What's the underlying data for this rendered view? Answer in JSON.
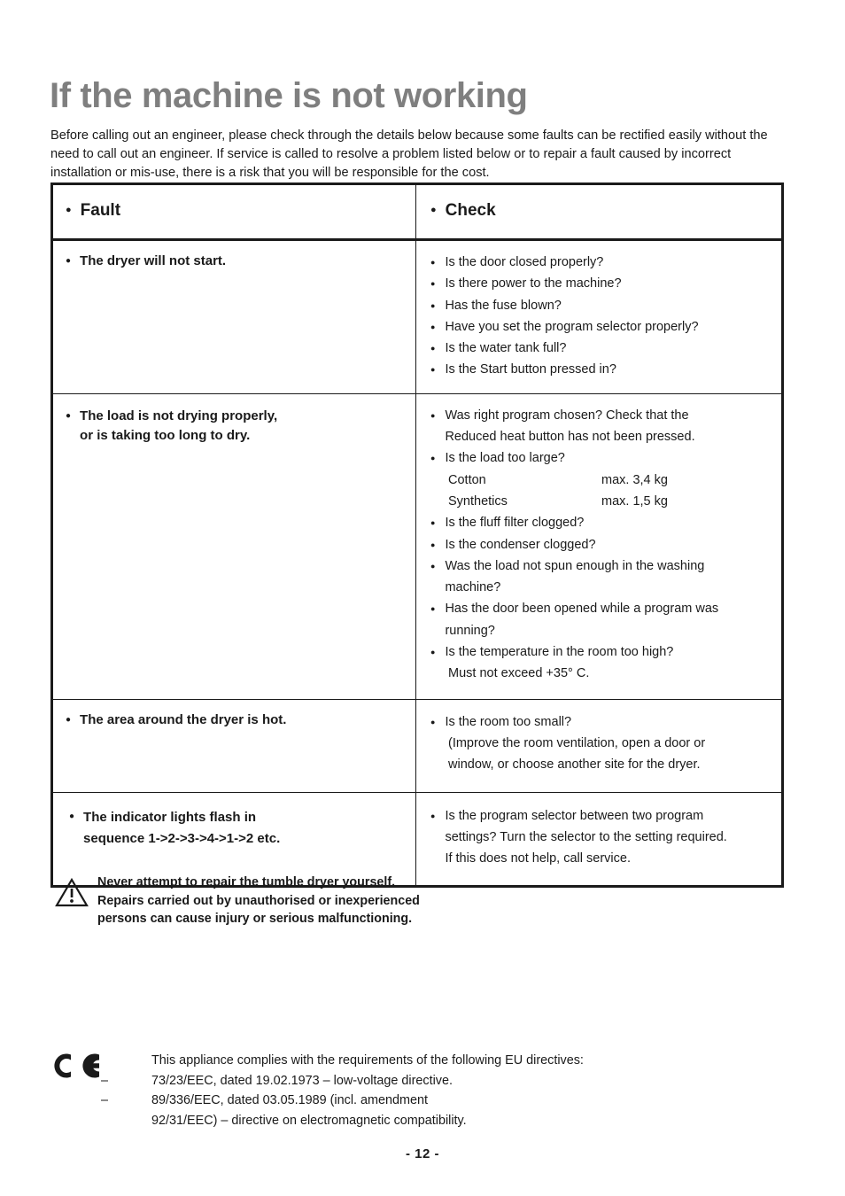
{
  "document": {
    "title": "If the machine is not working",
    "intro": "Before calling out an engineer, please check through the details below because some faults can be rectified easily without the need to call out an engineer. If service is called to resolve a problem listed below or to repair a fault caused by incorrect installation or mis-use, there is a risk that you will be responsible for the cost.",
    "page_number": "- 12 -",
    "title_color": "#7f7f7f",
    "text_color": "#1a1a1a"
  },
  "table": {
    "headers": {
      "fault": "Fault",
      "check": "Check"
    },
    "rows": [
      {
        "fault": "The dryer will not start.",
        "checks": [
          {
            "kind": "bullet",
            "text": "Is the door closed properly?"
          },
          {
            "kind": "bullet",
            "text": "Is there power to the machine?"
          },
          {
            "kind": "bullet",
            "text": "Has the fuse blown?"
          },
          {
            "kind": "bullet",
            "text": "Have you set the program selector properly?"
          },
          {
            "kind": "bullet",
            "text": "Is the water tank full?"
          },
          {
            "kind": "bullet",
            "text": "Is the Start button pressed in?"
          }
        ]
      },
      {
        "fault": "The load is not drying properly,\nor is taking too long to dry.",
        "checks": [
          {
            "kind": "bullet",
            "text": "Was right program chosen? Check that the\nReduced heat button has not been pressed."
          },
          {
            "kind": "bullet",
            "text": "Is the load too large?"
          },
          {
            "kind": "pair",
            "label": "Cotton",
            "value": "max. 3,4 kg"
          },
          {
            "kind": "pair",
            "label": "Synthetics",
            "value": "max. 1,5 kg"
          },
          {
            "kind": "bullet",
            "text": "Is the fluff filter clogged?"
          },
          {
            "kind": "bullet",
            "text": "Is the condenser clogged?"
          },
          {
            "kind": "bullet",
            "text": "Was the load not spun enough in the washing\nmachine?"
          },
          {
            "kind": "bullet",
            "text": "Has the door been opened while a program was\nrunning?"
          },
          {
            "kind": "bullet",
            "text": "Is the temperature in the room too high?"
          },
          {
            "kind": "plain",
            "text": "Must not exceed +35° C."
          }
        ]
      },
      {
        "fault": "The area around the dryer is hot.",
        "checks": [
          {
            "kind": "bullet",
            "text": "Is the room too small?"
          },
          {
            "kind": "plain",
            "text": "(Improve the room ventilation, open a door or\nwindow, or choose another site for the dryer."
          }
        ]
      },
      {
        "fault": "The indicator lights flash in\nsequence 1->2->3->4->1->2 etc.",
        "checks": [
          {
            "kind": "bullet",
            "text": "Is the program selector between two program\nsettings? Turn the selector to the setting required.\nIf this does not help, call service."
          }
        ]
      }
    ]
  },
  "warning": {
    "icon": "warning-triangle-icon",
    "text": "Never attempt to repair the tumble dryer yourself.\nRepairs carried out by unauthorised or inexperienced\npersons can cause injury or serious malfunctioning."
  },
  "compliance": {
    "mark": "ce-mark-icon",
    "lines": [
      {
        "dash": "",
        "text": "This appliance complies with the requirements of the following EU directives:"
      },
      {
        "dash": "–",
        "text": "73/23/EEC, dated 19.02.1973 – low-voltage directive."
      },
      {
        "dash": "–",
        "text": "89/336/EEC, dated 03.05.1989 (incl. amendment\n92/31/EEC) – directive on electromagnetic compatibility."
      }
    ]
  },
  "bullet_glyph": "●"
}
